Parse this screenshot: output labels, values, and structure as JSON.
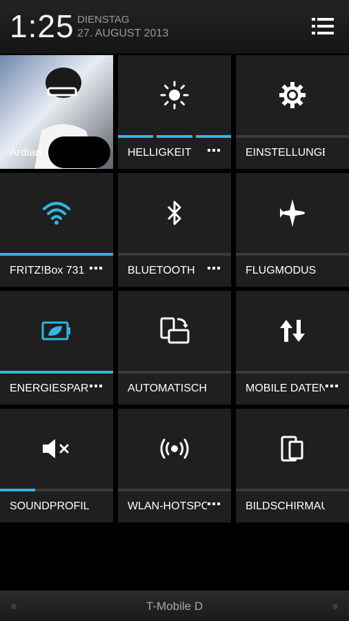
{
  "status": {
    "time": "1:25",
    "day": "DIENSTAG",
    "date": "27. AUGUST 2013"
  },
  "tiles": [
    {
      "label": "Ardian",
      "icon": "profile-photo",
      "bar": "none",
      "has_more": false
    },
    {
      "label": "HELLIGKEIT",
      "icon": "brightness-icon",
      "bar": "segments",
      "has_more": true
    },
    {
      "label": "EINSTELLUNGEN",
      "icon": "gear-icon",
      "bar": "off",
      "has_more": false
    },
    {
      "label": "FRITZ!Box 731",
      "icon": "wifi-icon",
      "bar": "on",
      "has_more": true
    },
    {
      "label": "BLUETOOTH",
      "icon": "bluetooth-icon",
      "bar": "off",
      "has_more": true
    },
    {
      "label": "FLUGMODUS",
      "icon": "airplane-icon",
      "bar": "off",
      "has_more": false
    },
    {
      "label": "ENERGIESPAR",
      "icon": "battery-leaf-icon",
      "bar": "on",
      "has_more": true
    },
    {
      "label": "AUTOMATISCH DR",
      "icon": "auto-rotate-icon",
      "bar": "off",
      "has_more": false
    },
    {
      "label": "MOBILE DATEN",
      "icon": "mobile-data-icon",
      "bar": "off",
      "has_more": true
    },
    {
      "label": "SOUNDPROFIL",
      "icon": "mute-icon",
      "bar": "partial",
      "bar_level": 0.31,
      "has_more": false
    },
    {
      "label": "WLAN-HOTSPOT",
      "icon": "hotspot-icon",
      "bar": "off",
      "has_more": true
    },
    {
      "label": "BILDSCHIRMAUFN",
      "icon": "screenshot-icon",
      "bar": "off",
      "has_more": false
    }
  ],
  "footer": {
    "carrier": "T-Mobile D"
  },
  "colors": {
    "accent": "#33b5e5",
    "tile": "#1f1f1f",
    "background": "#000000"
  }
}
